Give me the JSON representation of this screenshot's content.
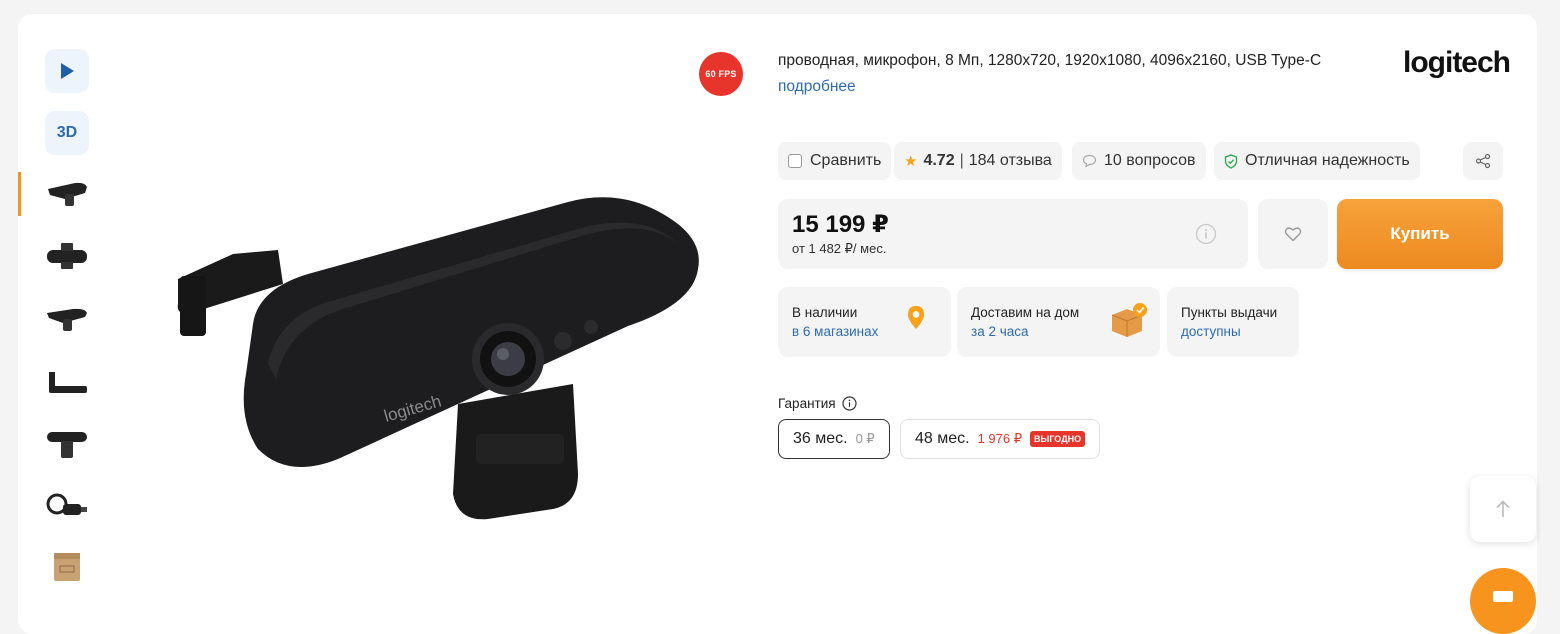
{
  "gallery": {
    "video_icon": "play-icon",
    "three_d_label": "3D",
    "active_index": 0
  },
  "badge": {
    "fps": "60 FPS"
  },
  "product": {
    "specs": "проводная, микрофон, 8 Мп, 1280x720, 1920x1080, 4096x2160, USB Type-C",
    "more_link": "подробнее",
    "brand": "logitech"
  },
  "actions": {
    "compare_label": "Сравнить",
    "rating_value": "4.72",
    "rating_separator": "|",
    "reviews_label": "184 отзыва",
    "questions_label": "10 вопросов",
    "reliability_label": "Отличная надежность"
  },
  "price": {
    "value": "15 199 ₽",
    "credit": "от 1 482 ₽/ мес."
  },
  "buy": {
    "label": "Купить"
  },
  "availability": [
    {
      "title": "В наличии",
      "link": "в 6 магазинах"
    },
    {
      "title": "Доставим на дом",
      "link": "за 2 часа"
    },
    {
      "title": "Пункты выдачи",
      "link": "доступны"
    }
  ],
  "warranty": {
    "label": "Гарантия",
    "options": [
      {
        "term": "36 мес.",
        "price": "0 ₽",
        "selected": true
      },
      {
        "term": "48 мес.",
        "price": "1 976 ₽",
        "badge": "ВЫГОДНО",
        "selected": false
      }
    ]
  },
  "colors": {
    "accent": "#f7941d",
    "link": "#2d6bb5",
    "red": "#e8352b",
    "chip_bg": "#f4f4f4"
  }
}
